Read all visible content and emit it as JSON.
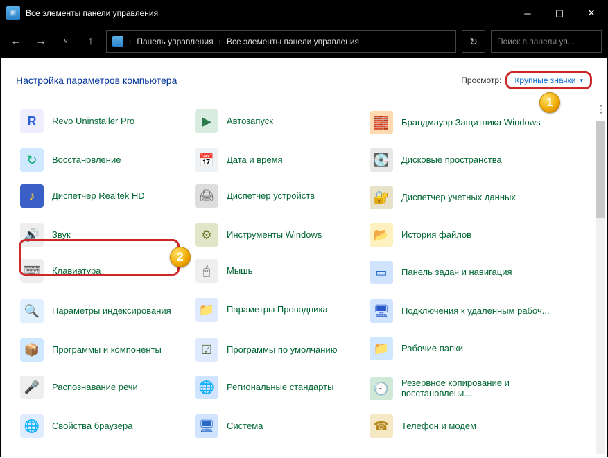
{
  "window": {
    "title": "Все элементы панели управления"
  },
  "breadcrumb": {
    "root": "Панель управления",
    "current": "Все элементы панели управления"
  },
  "search": {
    "placeholder": "Поиск в панели уп..."
  },
  "header": {
    "title": "Настройка параметров компьютера"
  },
  "view": {
    "label": "Просмотр:",
    "value": "Крупные значки"
  },
  "callouts": {
    "b1": "1",
    "b2": "2"
  },
  "items": {
    "c0": "Revo Uninstaller Pro",
    "c1": "Автозапуск",
    "c2": "Брандмауэр Защитника Windows",
    "c3": "Восстановление",
    "c4": "Дата и время",
    "c5": "Дисковые пространства",
    "c6": "Диспетчер Realtek HD",
    "c7": "Диспетчер устройств",
    "c8": "Диспетчер учетных данных",
    "c9": "Звук",
    "c10": "Инструменты Windows",
    "c11": "История файлов",
    "c12": "Клавиатура",
    "c13": "Мышь",
    "c14": "Панель задач и навигация",
    "c15": "Параметры индексирования",
    "c16": "Параметры Проводника",
    "c17": "Подключения к удаленным рабоч...",
    "c18": "Программы и компоненты",
    "c19": "Программы по умолчанию",
    "c20": "Рабочие папки",
    "c21": "Распознавание речи",
    "c22": "Региональные стандарты",
    "c23": "Резервное копирование и восстановлени...",
    "c24": "Свойства браузера",
    "c25": "Система",
    "c26": "Телефон и модем"
  }
}
